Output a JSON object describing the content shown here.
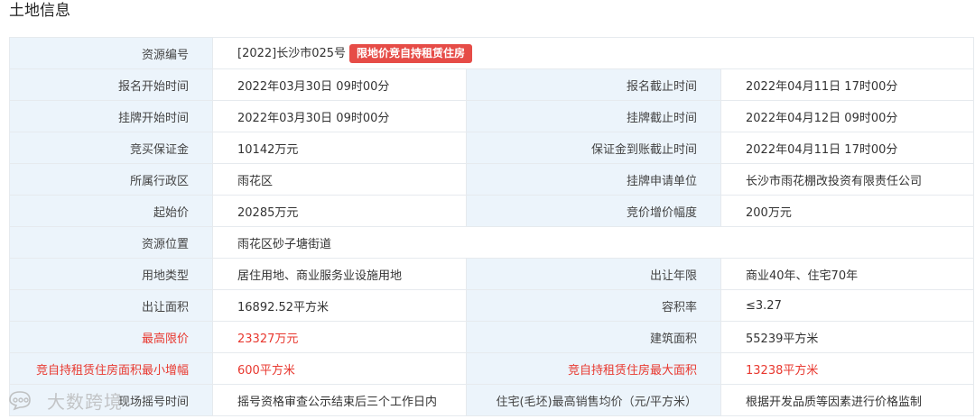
{
  "section_title": "土地信息",
  "rows": {
    "r1": {
      "l1": "资源编号",
      "v1": "[2022]长沙市025号",
      "badge": "限地价竞自持租赁住房"
    },
    "r2": {
      "l1": "报名开始时间",
      "v1": "2022年03月30日 09时00分",
      "l2": "报名截止时间",
      "v2": "2022年04月11日 17时00分"
    },
    "r3": {
      "l1": "挂牌开始时间",
      "v1": "2022年03月30日 09时00分",
      "l2": "挂牌截止时间",
      "v2": "2022年04月12日 09时00分"
    },
    "r4": {
      "l1": "竞买保证金",
      "v1": "10142万元",
      "l2": "保证金到账截止时间",
      "v2": "2022年04月11日 17时00分"
    },
    "r5": {
      "l1": "所属行政区",
      "v1": "雨花区",
      "l2": "挂牌申请单位",
      "v2": "长沙市雨花棚改投资有限责任公司"
    },
    "r6": {
      "l1": "起始价",
      "v1": "20285万元",
      "l2": "竞价增价幅度",
      "v2": "200万元"
    },
    "r7": {
      "l1": "资源位置",
      "v1": "雨花区砂子塘街道"
    },
    "r8": {
      "l1": "用地类型",
      "v1": "居住用地、商业服务业设施用地",
      "l2": "出让年限",
      "v2": "商业40年、住宅70年"
    },
    "r9": {
      "l1": "出让面积",
      "v1": "16892.52平方米",
      "l2": "容积率",
      "v2": "≤3.27"
    },
    "r10": {
      "l1": "最高限价",
      "v1": "23327万元",
      "l2": "建筑面积",
      "v2": "55239平方米"
    },
    "r11": {
      "l1": "竞自持租赁住房面积最小增幅",
      "v1": "600平方米",
      "l2": "竞自持租赁住房最大面积",
      "v2": "13238平方米"
    },
    "r12": {
      "l1": "现场摇号时间",
      "v1": "摇号资格审查公示结束后三个工作日内",
      "l2": "住宅(毛坯)最高销售均价（元/平方米）",
      "v2": "根据开发品质等因素进行价格监制"
    }
  },
  "watermark": "大数跨境",
  "colors": {
    "label_bg": "#ecf4fb",
    "highlight_red": "#e8382f",
    "badge_bg": "#e64c47",
    "border": "#e6eaee"
  }
}
